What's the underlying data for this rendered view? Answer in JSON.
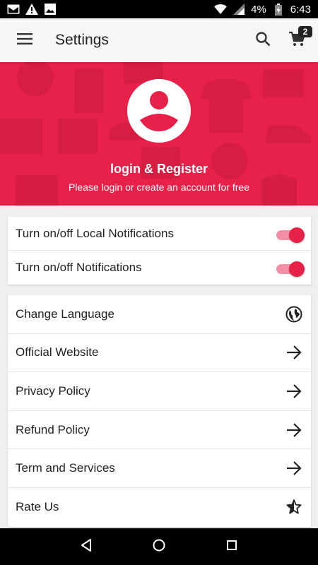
{
  "status_bar": {
    "battery": "4%",
    "time": "6:43",
    "icons": [
      "gmail-icon",
      "warning-icon",
      "image-icon",
      "wifi-icon",
      "signal-icon",
      "battery-charging-icon"
    ]
  },
  "app_bar": {
    "title": "Settings",
    "cart_count": "2",
    "icons": [
      "menu-icon",
      "search-icon",
      "cart-icon"
    ]
  },
  "profile": {
    "title": "login & Register",
    "subtitle": "Please login or create an account for free"
  },
  "toggles": [
    {
      "label": "Turn on/off Local Notifications",
      "on": true
    },
    {
      "label": "Turn on/off Notifications",
      "on": true
    }
  ],
  "menu": [
    {
      "label": "Change Language",
      "icon": "globe-icon"
    },
    {
      "label": "Official Website",
      "icon": "arrow-right-icon"
    },
    {
      "label": "Privacy Policy",
      "icon": "arrow-right-icon"
    },
    {
      "label": "Refund Policy",
      "icon": "arrow-right-icon"
    },
    {
      "label": "Term and Services",
      "icon": "arrow-right-icon"
    },
    {
      "label": "Rate Us",
      "icon": "star-half-icon"
    }
  ],
  "colors": {
    "accent": "#e8214a",
    "switch_track": "#f28fa4",
    "background": "#efefef"
  }
}
